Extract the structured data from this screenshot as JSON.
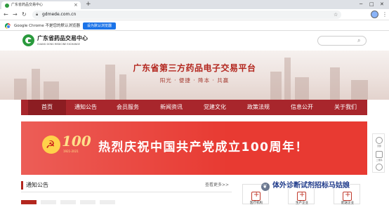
{
  "browser": {
    "tab_title": "广东省药品交易中心",
    "url": "gdmede.com.cn",
    "new_tab": "+",
    "close": "×",
    "back": "←",
    "forward": "→",
    "reload": "↻",
    "menu": "⋮",
    "star": "☆",
    "info_text": "Google Chrome 不是您的默认浏览器",
    "set_default_label": "设为默认浏览器"
  },
  "site": {
    "logo_cn": "广东省药品交易中心",
    "logo_en": "GUANG DONG MEDICINE EXCHANGE",
    "search_icon": "⌕"
  },
  "hero": {
    "title": "广东省第三方药品电子交易平台",
    "subtitle": "阳光 · 便捷 · 降本 · 共赢"
  },
  "nav": {
    "items": [
      "首页",
      "通知公告",
      "会员服务",
      "新闻资讯",
      "党建文化",
      "政策法规",
      "信息公开",
      "关于我们"
    ]
  },
  "banner": {
    "badge_number": "100",
    "badge_years": "1921-2021",
    "title": "热烈庆祝中国共产党成立100周年！"
  },
  "side": {
    "top_label": "顶部",
    "qr_label": "二维码"
  },
  "notice": {
    "title": "通知公告",
    "more": "查看更多>>"
  },
  "cards": {
    "c1": "医疗机构",
    "c2": "生产企业",
    "c3": "配送企业"
  },
  "watermark": "体外诊断试剂招标马姑娘",
  "colors": {
    "brand_red": "#a8262c",
    "banner_red": "#e83a32",
    "logo_green": "#2a9a3d",
    "chrome_blue": "#1a73e8"
  },
  "icons": [
    "favicon-icon",
    "lock-icon",
    "star-icon",
    "profile-icon",
    "chrome-icon",
    "logo-icon",
    "search-icon",
    "party-emblem-icon"
  ]
}
